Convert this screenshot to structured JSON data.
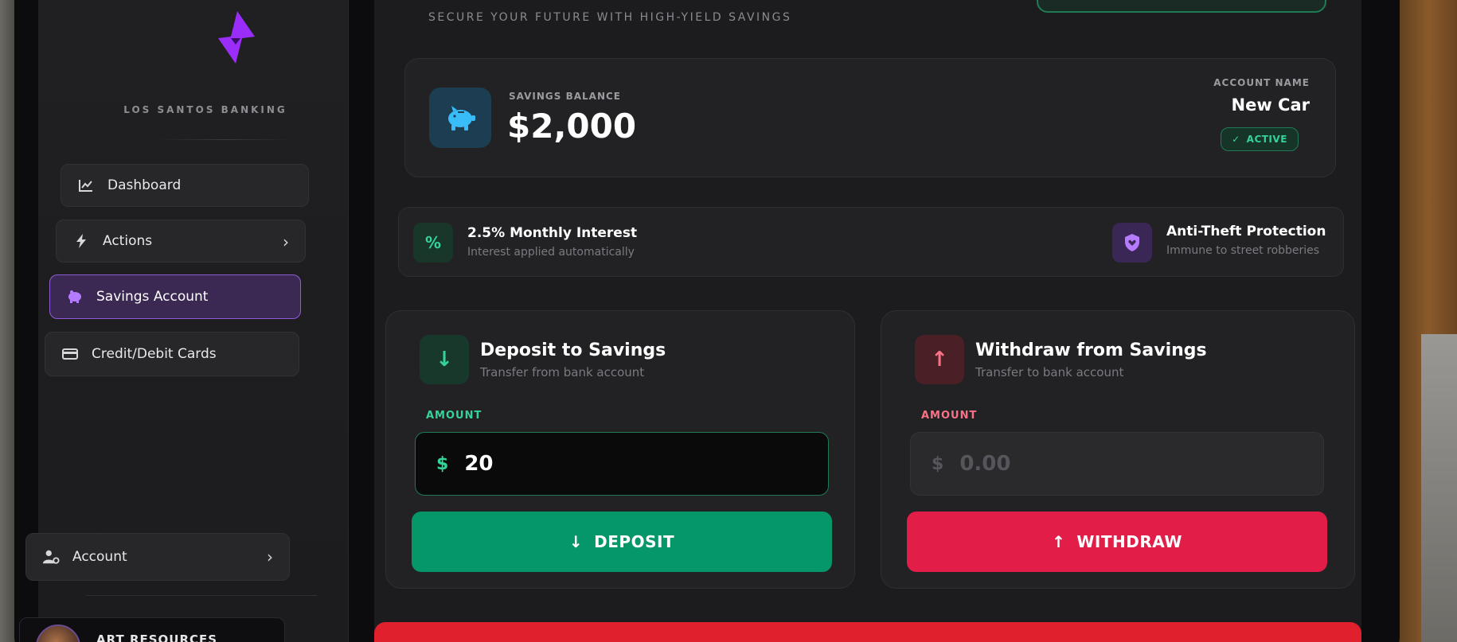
{
  "brand": {
    "name": "LOS SANTOS BANKING",
    "logo_icon": "lightning-bolt-logo-icon",
    "logo_color": "#9b2dfa"
  },
  "sidebar": {
    "items": [
      {
        "label": "Dashboard",
        "icon": "chart-line-icon",
        "active": false
      },
      {
        "label": "Actions",
        "icon": "bolt-icon",
        "active": false,
        "has_chevron": true
      },
      {
        "label": "Savings Account",
        "icon": "piggy-bank-icon",
        "active": true
      },
      {
        "label": "Credit/Debit Cards",
        "icon": "credit-card-icon",
        "active": false
      }
    ],
    "account": {
      "label": "Account",
      "icon": "user-gear-icon"
    },
    "art_resources": {
      "label": "ART RESOURCES"
    }
  },
  "header": {
    "tagline": "SECURE YOUR FUTURE WITH HIGH-YIELD SAVINGS"
  },
  "balance": {
    "label": "SAVINGS BALANCE",
    "value": "$2,000",
    "account_label": "ACCOUNT NAME",
    "account_name": "New Car",
    "status": "ACTIVE"
  },
  "features": [
    {
      "title": "2.5% Monthly Interest",
      "subtitle": "Interest applied automatically",
      "icon": "percent-icon"
    },
    {
      "title": "Anti-Theft Protection",
      "subtitle": "Immune to street robberies",
      "icon": "shield-heart-icon"
    }
  ],
  "deposit": {
    "title": "Deposit to Savings",
    "subtitle": "Transfer from bank account",
    "amount_label": "AMOUNT",
    "currency": "$",
    "value": "20",
    "button_label": "DEPOSIT"
  },
  "withdraw": {
    "title": "Withdraw from Savings",
    "subtitle": "Transfer to bank account",
    "amount_label": "AMOUNT",
    "currency": "$",
    "placeholder": "0.00",
    "button_label": "WITHDRAW"
  },
  "colors": {
    "accent_purple": "#8f5ad6",
    "deposit_green": "#059669",
    "withdraw_red": "#e11d48",
    "active_green": "#34d399"
  }
}
